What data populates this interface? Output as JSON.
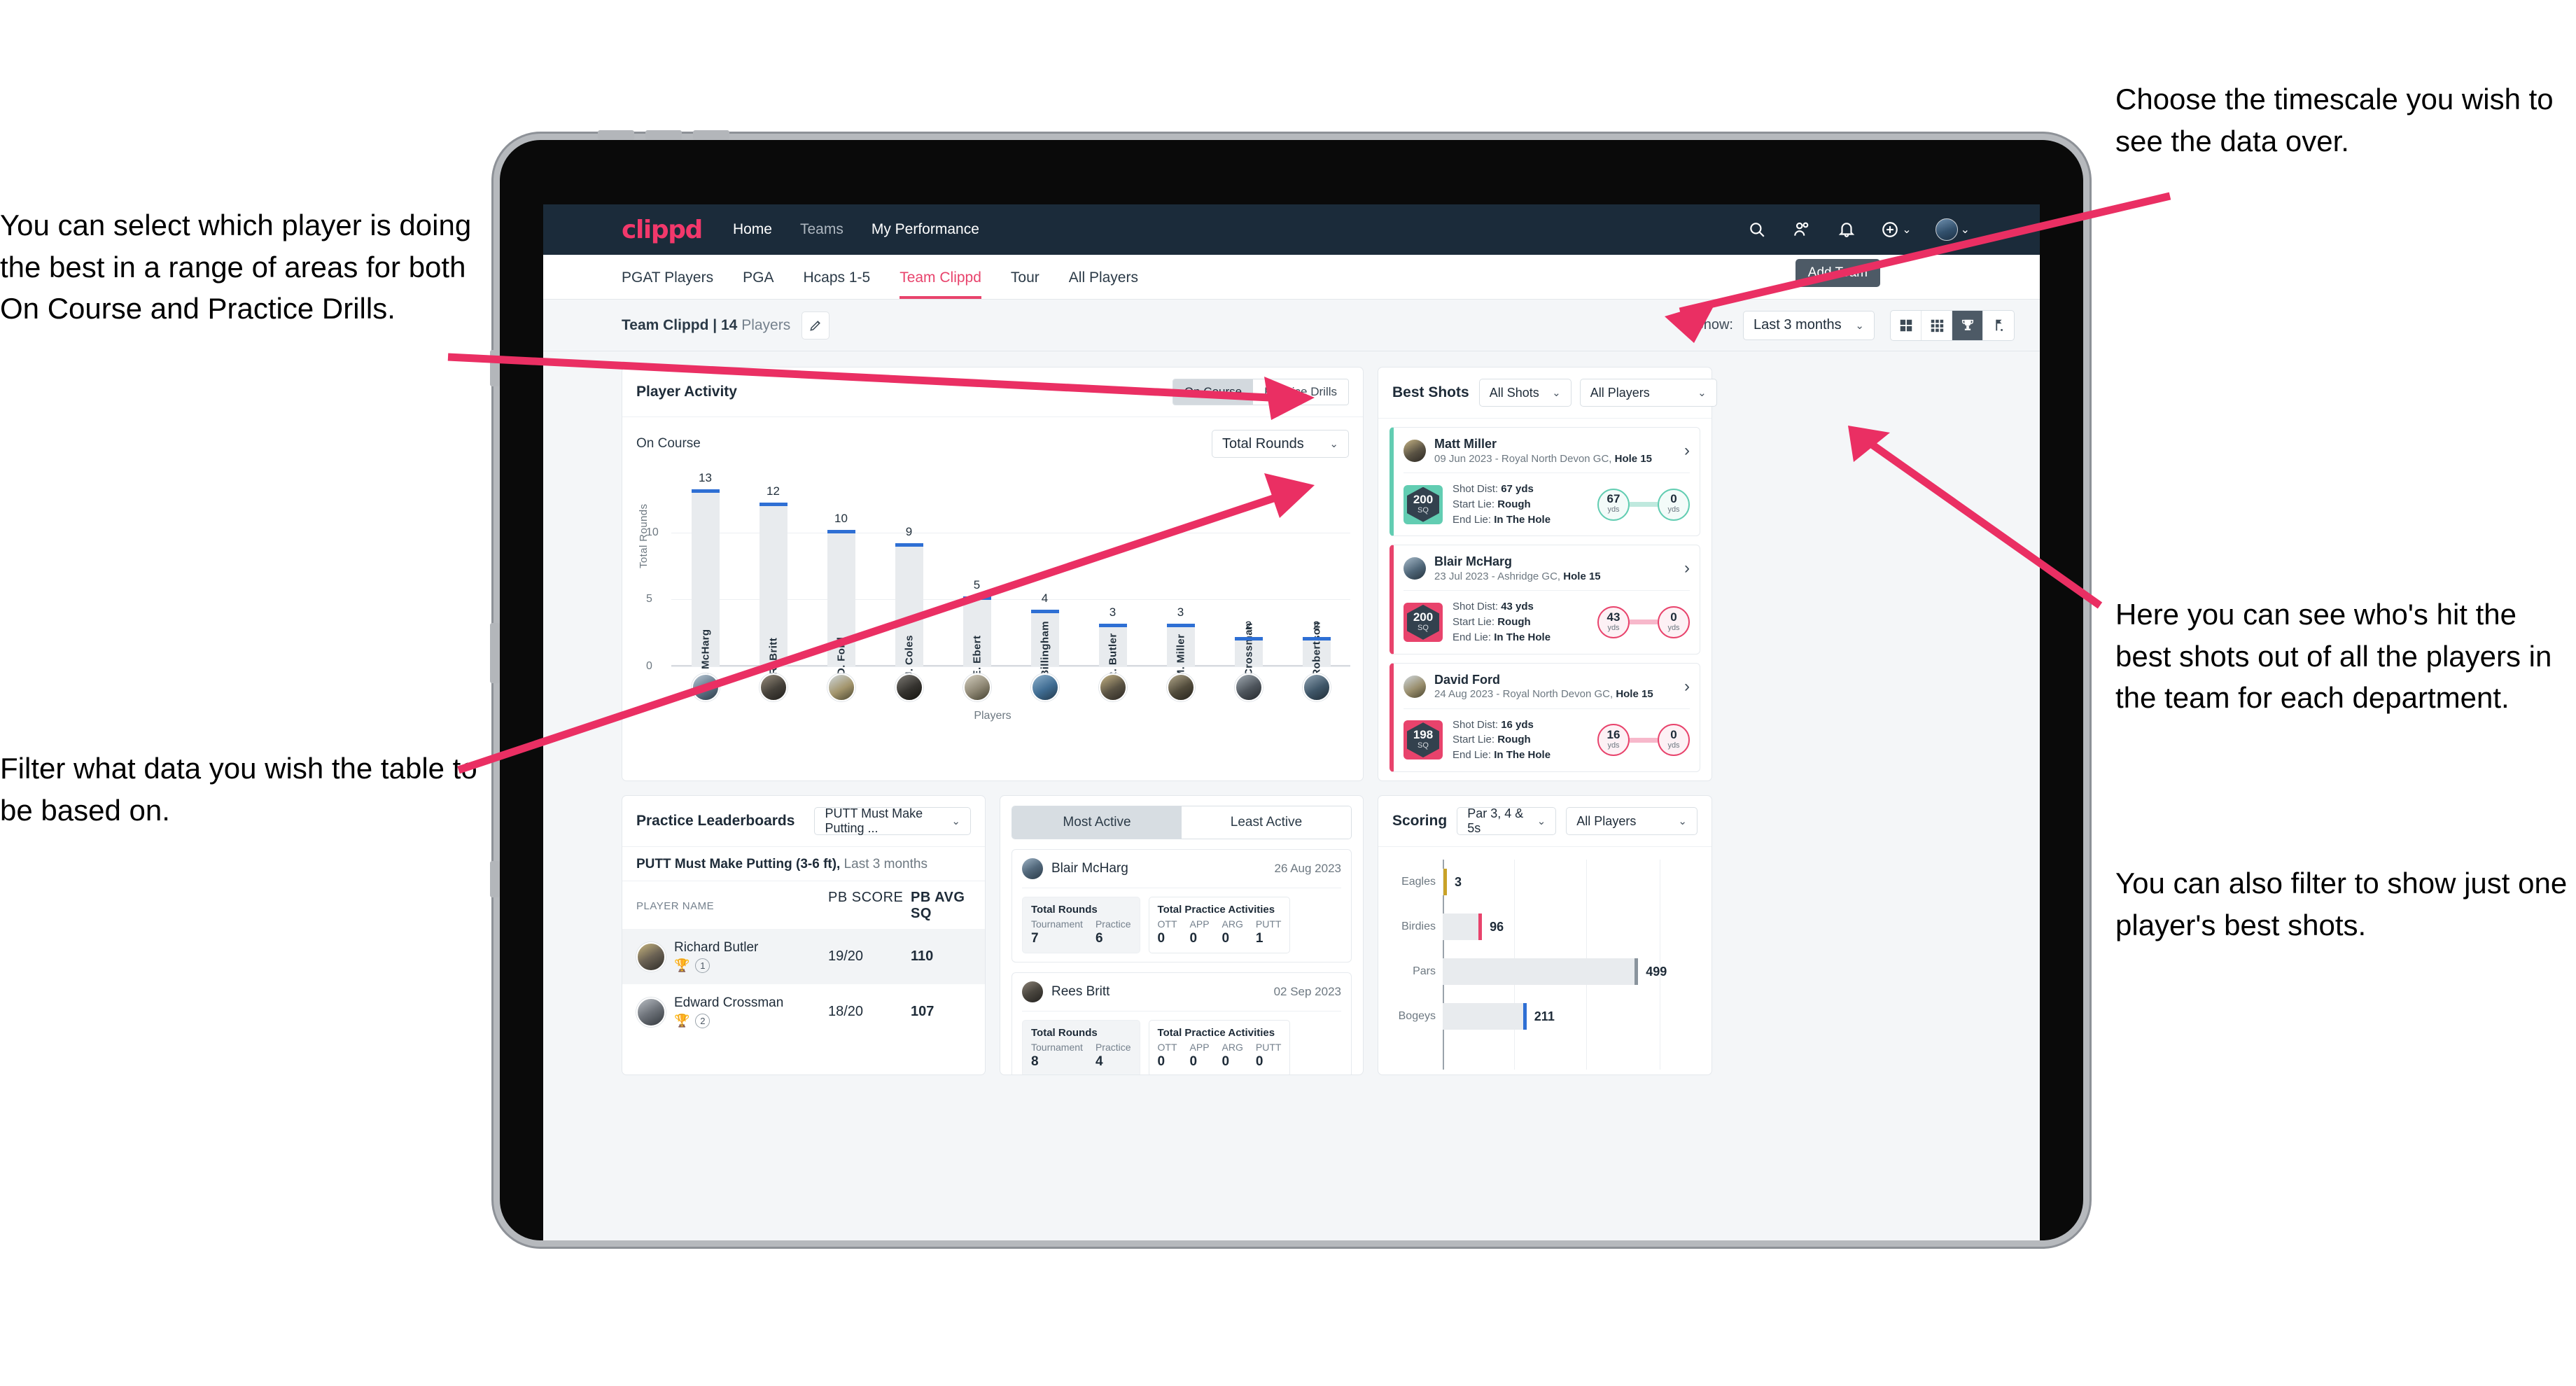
{
  "annotations": {
    "left_top": "You can select which player is doing the best in a range of areas for both On Course and Practice Drills.",
    "left_bottom": "Filter what data you wish the table to be based on.",
    "right_top": "Choose the timescale you wish to see the data over.",
    "right_middle": "Here you can see who's hit the best shots out of all the players in the team for each department.",
    "right_bottom": "You can also filter to show just one player's best shots."
  },
  "topnav": {
    "logo": "clippd",
    "links": [
      {
        "label": "Home",
        "active": true
      },
      {
        "label": "Teams",
        "active": false
      },
      {
        "label": "My Performance",
        "active": true
      }
    ],
    "icons": [
      "search-icon",
      "people-icon",
      "bell-icon",
      "plus-circle-icon",
      "avatar"
    ]
  },
  "tabs": {
    "items": [
      {
        "label": "PGAT Players",
        "active": false
      },
      {
        "label": "PGA",
        "active": false
      },
      {
        "label": "Hcaps 1-5",
        "active": false
      },
      {
        "label": "Team Clippd",
        "active": true
      },
      {
        "label": "Tour",
        "active": false
      },
      {
        "label": "All Players",
        "active": false
      }
    ],
    "tooltip": "Add Team"
  },
  "subheader": {
    "team_name": "Team Clippd",
    "separator": " | ",
    "player_count": "14",
    "players_word": " Players",
    "show_label": "Show:",
    "timescale_value": "Last 3 months",
    "view_buttons": [
      "grid-large-icon",
      "grid-small-icon",
      "trophy-icon",
      "flag-icon"
    ],
    "active_view": "trophy-icon"
  },
  "player_activity": {
    "title": "Player Activity",
    "segments": [
      {
        "label": "On Course",
        "active": true
      },
      {
        "label": "Practice Drills",
        "active": false
      }
    ],
    "sub_label": "On Course",
    "metric_value": "Total Rounds"
  },
  "chart_data": {
    "type": "bar",
    "title": "Player Activity - On Course",
    "xlabel": "Players",
    "ylabel": "Total Rounds",
    "ylim": [
      0,
      14
    ],
    "yticks": [
      "0",
      "5",
      "10"
    ],
    "grid": true,
    "categories": [
      "B. McHarg",
      "R. Britt",
      "D. Ford",
      "J. Coles",
      "E. Ebert",
      "D. Billingham",
      "R. Butler",
      "M. Miller",
      "E. Crossman",
      "C. Robertson"
    ],
    "values": [
      13,
      12,
      10,
      9,
      5,
      4,
      3,
      3,
      2,
      2
    ]
  },
  "best_shots": {
    "title": "Best Shots",
    "shot_filter": "All Shots",
    "player_filter": "All Players",
    "cards": [
      {
        "accent": "teal",
        "name": "Matt Miller",
        "meta_date": "09 Jun 2023 - Royal North Devon GC, ",
        "meta_hole": "Hole 15",
        "sq_value": "200",
        "sq_unit": "SQ",
        "shot_dist_label": "Shot Dist: ",
        "shot_dist_value": "67 yds",
        "start_lie_label": "Start Lie: ",
        "start_lie_value": "Rough",
        "end_lie_label": "End Lie: ",
        "end_lie_value": "In The Hole",
        "from_value": "67",
        "from_unit": "yds",
        "to_value": "0",
        "to_unit": "yds"
      },
      {
        "accent": "pink",
        "name": "Blair McHarg",
        "meta_date": "23 Jul 2023 - Ashridge GC, ",
        "meta_hole": "Hole 15",
        "sq_value": "200",
        "sq_unit": "SQ",
        "shot_dist_label": "Shot Dist: ",
        "shot_dist_value": "43 yds",
        "start_lie_label": "Start Lie: ",
        "start_lie_value": "Rough",
        "end_lie_label": "End Lie: ",
        "end_lie_value": "In The Hole",
        "from_value": "43",
        "from_unit": "yds",
        "to_value": "0",
        "to_unit": "yds"
      },
      {
        "accent": "pink",
        "name": "David Ford",
        "meta_date": "24 Aug 2023 - Royal North Devon GC, ",
        "meta_hole": "Hole 15",
        "sq_value": "198",
        "sq_unit": "SQ",
        "shot_dist_label": "Shot Dist: ",
        "shot_dist_value": "16 yds",
        "start_lie_label": "Start Lie: ",
        "start_lie_value": "Rough",
        "end_lie_label": "End Lie: ",
        "end_lie_value": "In The Hole",
        "from_value": "16",
        "from_unit": "yds",
        "to_value": "0",
        "to_unit": "yds"
      }
    ]
  },
  "practice_leaderboards": {
    "title": "Practice Leaderboards",
    "drill_value": "PUTT Must Make Putting ...",
    "subtitle_bold": "PUTT Must Make Putting (3-6 ft),",
    "subtitle_rest": " Last 3 months",
    "columns": [
      "PLAYER NAME",
      "PB SCORE",
      "PB AVG SQ"
    ],
    "rows": [
      {
        "name": "Richard Butler",
        "rank": "1",
        "trophy": "gold",
        "pb_score": "19/20",
        "pb_avg_sq": "110"
      },
      {
        "name": "Edward Crossman",
        "rank": "2",
        "trophy": "silver",
        "pb_score": "18/20",
        "pb_avg_sq": "107"
      }
    ]
  },
  "activity": {
    "tabs": [
      {
        "label": "Most Active",
        "active": true
      },
      {
        "label": "Least Active",
        "active": false
      }
    ],
    "items": [
      {
        "name": "Blair McHarg",
        "date": "26 Aug 2023",
        "rounds_title": "Total Rounds",
        "rounds_keys": [
          "Tournament",
          "Practice"
        ],
        "rounds_values": [
          "7",
          "6"
        ],
        "practice_title": "Total Practice Activities",
        "practice_keys": [
          "OTT",
          "APP",
          "ARG",
          "PUTT"
        ],
        "practice_values": [
          "0",
          "0",
          "0",
          "1"
        ]
      },
      {
        "name": "Rees Britt",
        "date": "02 Sep 2023",
        "rounds_title": "Total Rounds",
        "rounds_keys": [
          "Tournament",
          "Practice"
        ],
        "rounds_values": [
          "8",
          "4"
        ],
        "practice_title": "Total Practice Activities",
        "practice_keys": [
          "OTT",
          "APP",
          "ARG",
          "PUTT"
        ],
        "practice_values": [
          "0",
          "0",
          "0",
          "0"
        ]
      }
    ]
  },
  "scoring": {
    "title": "Scoring",
    "par_filter": "Par 3, 4 & 5s",
    "player_filter": "All Players",
    "chart": {
      "type": "bar",
      "orientation": "horizontal",
      "categories": [
        "Eagles",
        "Birdies",
        "Pars",
        "Bogeys"
      ],
      "values": [
        3,
        96,
        499,
        211
      ],
      "xlim": [
        0,
        560
      ],
      "grid": true
    }
  },
  "colors": {
    "brand_pink": "#e8436c",
    "nav_dark": "#1b2b3a",
    "bar_blue": "#2e6fd4",
    "teal": "#62cdb2",
    "gold": "#c9a227",
    "grey_bar": "#8a949d"
  }
}
